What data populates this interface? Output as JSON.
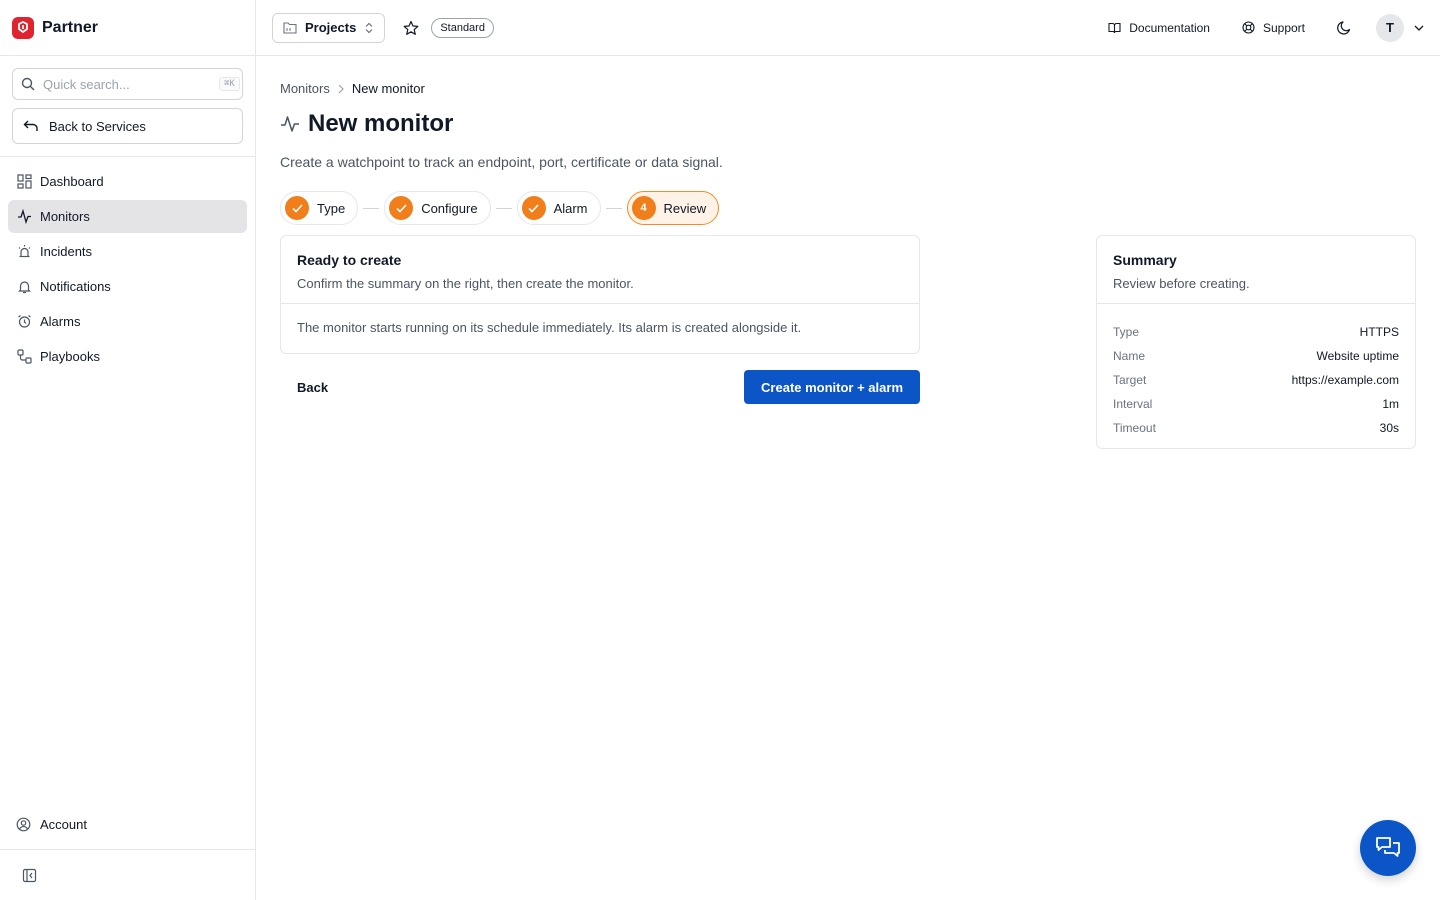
{
  "brand": {
    "name": "Partner",
    "color": "#e0242f"
  },
  "search": {
    "placeholder": "Quick search...",
    "shortcut": "⌘K"
  },
  "sidebar": {
    "back_label": "Back to Services",
    "items": [
      {
        "label": "Dashboard",
        "icon": "dashboard-icon",
        "active": false
      },
      {
        "label": "Monitors",
        "icon": "activity-icon",
        "active": true
      },
      {
        "label": "Incidents",
        "icon": "siren-icon",
        "active": false
      },
      {
        "label": "Notifications",
        "icon": "bell-icon",
        "active": false
      },
      {
        "label": "Alarms",
        "icon": "alarm-clock-icon",
        "active": false
      },
      {
        "label": "Playbooks",
        "icon": "workflow-icon",
        "active": false
      }
    ],
    "account_label": "Account"
  },
  "header": {
    "projects_label": "Projects",
    "plan_badge": "Standard",
    "documentation_label": "Documentation",
    "support_label": "Support",
    "avatar_initial": "T"
  },
  "breadcrumb": {
    "parent": "Monitors",
    "current": "New monitor"
  },
  "page": {
    "title": "New monitor",
    "subtitle": "Create a watchpoint to track an endpoint, port, certificate or data signal."
  },
  "stepper": {
    "steps": [
      {
        "label": "Type",
        "state": "done"
      },
      {
        "label": "Configure",
        "state": "done"
      },
      {
        "label": "Alarm",
        "state": "done"
      },
      {
        "label": "Review",
        "state": "current",
        "number": "4"
      }
    ],
    "accent": "#f07e1a"
  },
  "ready_card": {
    "title": "Ready to create",
    "description": "Confirm the summary on the right, then create the monitor.",
    "body": "The monitor starts running on its schedule immediately. Its alarm is created alongside it."
  },
  "actions": {
    "back_label": "Back",
    "create_label": "Create monitor + alarm",
    "primary_color": "#0b55c7"
  },
  "summary": {
    "title": "Summary",
    "description": "Review before creating.",
    "rows": [
      {
        "key": "Type",
        "value": "HTTPS"
      },
      {
        "key": "Name",
        "value": "Website uptime"
      },
      {
        "key": "Target",
        "value": "https://example.com"
      },
      {
        "key": "Interval",
        "value": "1m"
      },
      {
        "key": "Timeout",
        "value": "30s"
      }
    ]
  }
}
